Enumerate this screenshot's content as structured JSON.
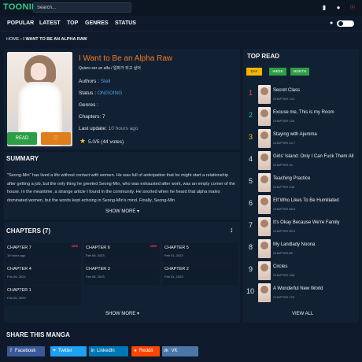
{
  "header": {
    "logo": "TOONILY",
    "search_placeholder": "Search...",
    "icons": [
      "bookmark-icon",
      "bell-icon",
      "user-icon"
    ]
  },
  "nav": {
    "items": [
      "POPULAR",
      "LATEST",
      "TOP",
      "GENRES",
      "STATUS"
    ],
    "theme_toggle": "moon-icon"
  },
  "breadcrumb": {
    "home": "HOME",
    "sep": "›",
    "current": "I WANT TO BE AN ALPHA RAW"
  },
  "manga": {
    "title": "I Want to Be an Alpha Raw",
    "alt_title": "Quiero ser un alfa / 알파가 되고 싶어",
    "authors_label": "Authors :",
    "authors_value": "Stell",
    "status_label": "Status :",
    "status_value": "ONGOING",
    "genres_label": "Genres :",
    "chapters_label": "Chapters:",
    "chapters_value": "7",
    "last_update_label": "Last update:",
    "last_update_value": "10 hours ago",
    "rating": "5.0",
    "rating_max": "/5",
    "votes": "(44 votes)",
    "read_label": "READ",
    "fav_icon": "heart-icon"
  },
  "summary": {
    "title": "SUMMARY",
    "text": "\"Seong-Min\" has lived a life without contact with women. He was full of anticipation that he might start a relationship after getting a job, but the only thing he greeted Seong-Min, who was exhausted after work, was an empty corner of the house. In the meantime, a strange article I found in the community. He snorted when he heard that alpha males dominated women, but the words kept echoing in Seong-Min's mind. Finally, Seong-Min",
    "show_more": "SHOW MORE ▾"
  },
  "chapters": {
    "title": "CHAPTERS (7)",
    "sort_icon": "sort-icon",
    "items": [
      {
        "name": "CHAPTER 7",
        "date": "10 hours ago",
        "new": "NEW"
      },
      {
        "name": "CHAPTER 6",
        "date": "Feb 08, 2023",
        "new": "NEW"
      },
      {
        "name": "CHAPTER 5",
        "date": "Feb 01, 2023",
        "new": ""
      },
      {
        "name": "CHAPTER 4",
        "date": "Feb 05, 2023",
        "new": ""
      },
      {
        "name": "CHAPTER 3",
        "date": "Feb 05, 2023",
        "new": ""
      },
      {
        "name": "CHAPTER 2",
        "date": "Feb 01, 2023",
        "new": ""
      },
      {
        "name": "CHAPTER 1",
        "date": "Feb 05, 2023",
        "new": ""
      }
    ],
    "show_more": "SHOW MORE ▾"
  },
  "share": {
    "title": "SHARE THIS MANGA",
    "buttons": [
      {
        "label": "Facebook",
        "color": "#3b5998",
        "icon": "facebook-icon"
      },
      {
        "label": "Twitter",
        "color": "#1da1f2",
        "icon": "twitter-icon"
      },
      {
        "label": "LinkedIn",
        "color": "#0077b5",
        "icon": "linkedin-icon"
      },
      {
        "label": "Reddit",
        "color": "#ff4500",
        "icon": "reddit-icon"
      },
      {
        "label": "VK",
        "color": "#4a76a8",
        "icon": "vk-icon"
      }
    ]
  },
  "top_read": {
    "title": "TOP READ",
    "tabs": [
      {
        "label": "DAY",
        "color": "#f4b400",
        "text": "#222222"
      },
      {
        "label": "WEEK",
        "color": "#2e9e45",
        "text": "#ffffff"
      },
      {
        "label": "MONTH",
        "color": "#2e9e45",
        "text": "#ffffff"
      }
    ],
    "items": [
      {
        "rank": "1",
        "name": "Secret Class",
        "chapter": "CHAPTER 143",
        "color": "#e74c3c"
      },
      {
        "rank": "2",
        "name": "Excuse me, This is my Room",
        "chapter": "CHAPTER 126",
        "color": "#2ecc71"
      },
      {
        "rank": "3",
        "name": "Staying with Ajumma",
        "chapter": "CHAPTER 44.7",
        "color": "#f1c40f"
      },
      {
        "rank": "4",
        "name": "Girls' Island: Only I Can Fuck Them All",
        "chapter": "CHAPTER 15",
        "color": "#dfe6ee"
      },
      {
        "rank": "5",
        "name": "Teaching Practice",
        "chapter": "CHAPTER 108",
        "color": "#dfe6ee"
      },
      {
        "rank": "6",
        "name": "Elf Who Likes To Be Humiliated",
        "chapter": "CHAPTER 58.5",
        "color": "#dfe6ee"
      },
      {
        "rank": "7",
        "name": "It's Okay Because We're Family",
        "chapter": "CHAPTER 50.5",
        "color": "#dfe6ee"
      },
      {
        "rank": "8",
        "name": "My Landlady Noona",
        "chapter": "CHAPTER 85",
        "color": "#dfe6ee"
      },
      {
        "rank": "9",
        "name": "Circles",
        "chapter": "CHAPTER 158",
        "color": "#dfe6ee"
      },
      {
        "rank": "10",
        "name": "A Wonderful New World",
        "chapter": "CHAPTER 175",
        "color": "#dfe6ee"
      }
    ],
    "view_all": "VIEW ALL"
  }
}
